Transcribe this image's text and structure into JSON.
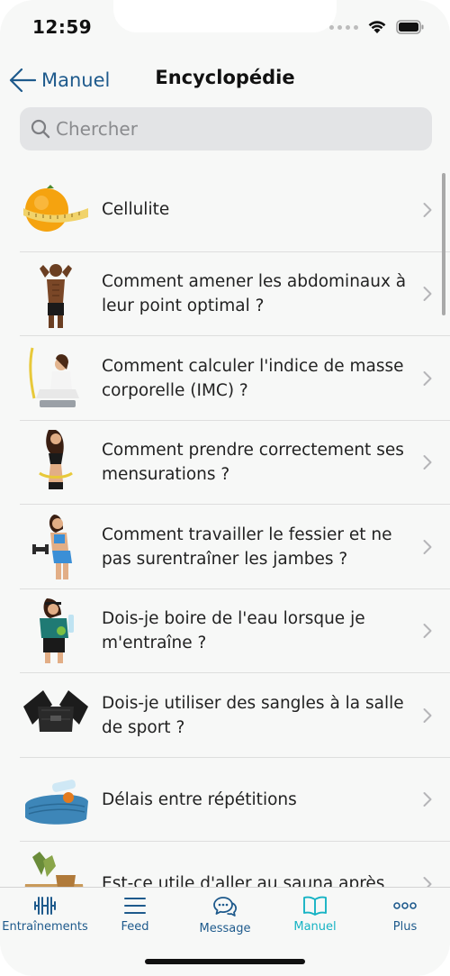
{
  "status_bar": {
    "time": "12:59"
  },
  "nav": {
    "back_label": "Manuel",
    "title": "Encyclopédie"
  },
  "search": {
    "placeholder": "Chercher",
    "value": ""
  },
  "list": [
    {
      "label": "Cellulite",
      "icon": "orange-measuring-tape-image"
    },
    {
      "label": "Comment amener les abdominaux à leur point optimal ?",
      "icon": "muscular-man-image"
    },
    {
      "label": "Comment calculer l'indice de masse corporelle (IMC) ?",
      "icon": "woman-on-scale-image"
    },
    {
      "label": "Comment prendre correctement ses mensurations ?",
      "icon": "woman-measuring-waist-image"
    },
    {
      "label": "Comment travailler le fessier et ne pas surentraîner les jambes ?",
      "icon": "woman-with-dumbbell-image"
    },
    {
      "label": "Dois-je boire de l'eau lorsque je m'entraîne ?",
      "icon": "woman-drinking-water-image"
    },
    {
      "label": "Dois-je utiliser des sangles à la salle de sport ?",
      "icon": "lifting-straps-image"
    },
    {
      "label": "Délais entre répétitions",
      "icon": "towel-and-water-image"
    },
    {
      "label": "Est-ce utile d'aller au sauna après",
      "icon": "sauna-herbs-image"
    }
  ],
  "tabs": [
    {
      "label": "Entraînements",
      "icon": "dumbbell-icon",
      "active": false
    },
    {
      "label": "Feed",
      "icon": "feed-lines-icon",
      "active": false
    },
    {
      "label": "Message",
      "icon": "chat-bubbles-icon",
      "active": false
    },
    {
      "label": "Manuel",
      "icon": "open-book-icon",
      "active": true
    },
    {
      "label": "Plus",
      "icon": "more-dots-icon",
      "active": false
    }
  ],
  "colors": {
    "accent": "#1e5a8c",
    "active_tab": "#16b3c4",
    "background": "#f7f8f7"
  }
}
